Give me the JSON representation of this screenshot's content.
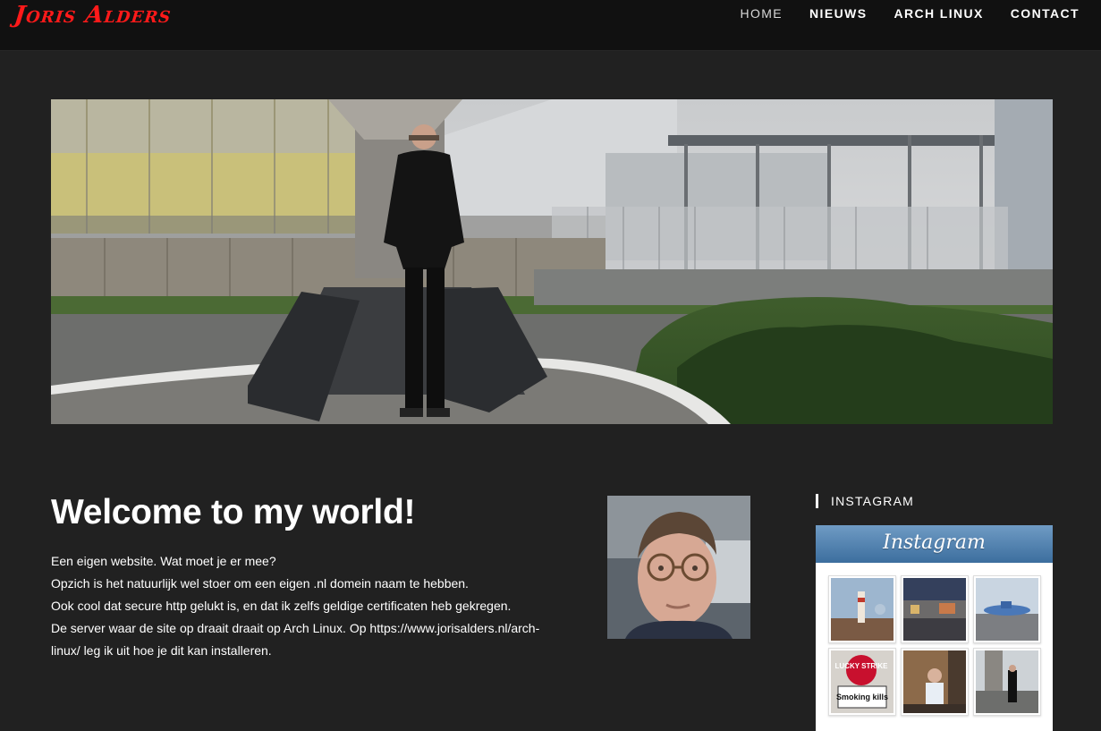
{
  "header": {
    "logo": "Joris Alders",
    "nav": [
      "HOME",
      "NIEUWS",
      "ARCH LINUX",
      "CONTACT"
    ]
  },
  "main": {
    "title": "Welcome to my world!",
    "paragraphs": [
      "Een eigen website. Wat moet je er mee?",
      "Opzich is het natuurlijk wel stoer om een eigen .nl domein naam te hebben.",
      "Ook cool dat secure http gelukt is, en dat ik zelfs geldige certificaten heb gekregen.",
      "De server waar de site op draait draait op Arch Linux. Op https://www.jorisalders.nl/arch-linux/ leg ik uit hoe je dit kan installeren."
    ]
  },
  "sidebar": {
    "widget_title": "INSTAGRAM",
    "instagram_logo": "Instagram",
    "thumb_sign_brand": "LUCKY STRIKE",
    "thumb_sign_warning": "Smoking kills"
  },
  "colors": {
    "background": "#212121",
    "header": "#111111",
    "logo": "#ff1a1a"
  }
}
